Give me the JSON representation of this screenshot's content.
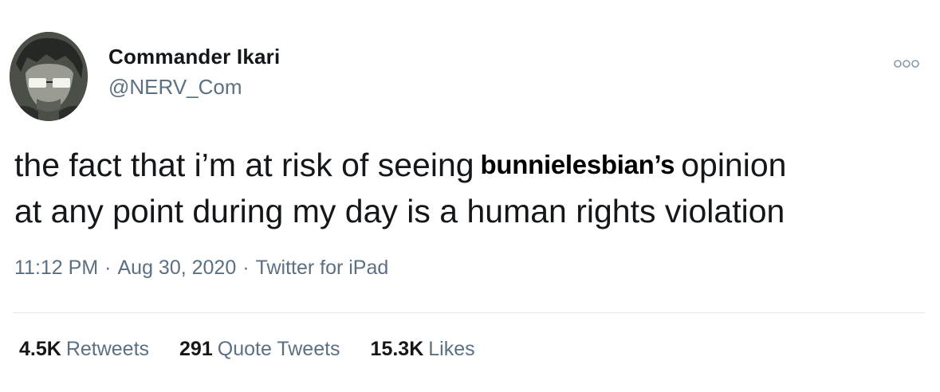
{
  "author": {
    "display_name": "Commander Ikari",
    "handle": "@NERV_Com"
  },
  "menu_icon": "more-dots-icon",
  "tweet": {
    "text_before": "the fact that i’m at risk of seeing",
    "mention": "bunnielesbian’s",
    "text_line1_end": "opinion",
    "text_line2": "at any point during my day is a human rights violation"
  },
  "meta": {
    "time": "11:12 PM",
    "separator": "·",
    "date": "Aug 30, 2020",
    "source": "Twitter for iPad"
  },
  "stats": {
    "retweets": {
      "count": "4.5K",
      "label": "Retweets"
    },
    "quotes": {
      "count": "291",
      "label": "Quote Tweets"
    },
    "likes": {
      "count": "15.3K",
      "label": "Likes"
    }
  },
  "colors": {
    "text": "#14171a",
    "secondary": "#5b7083",
    "divider": "#e1e8ed"
  }
}
